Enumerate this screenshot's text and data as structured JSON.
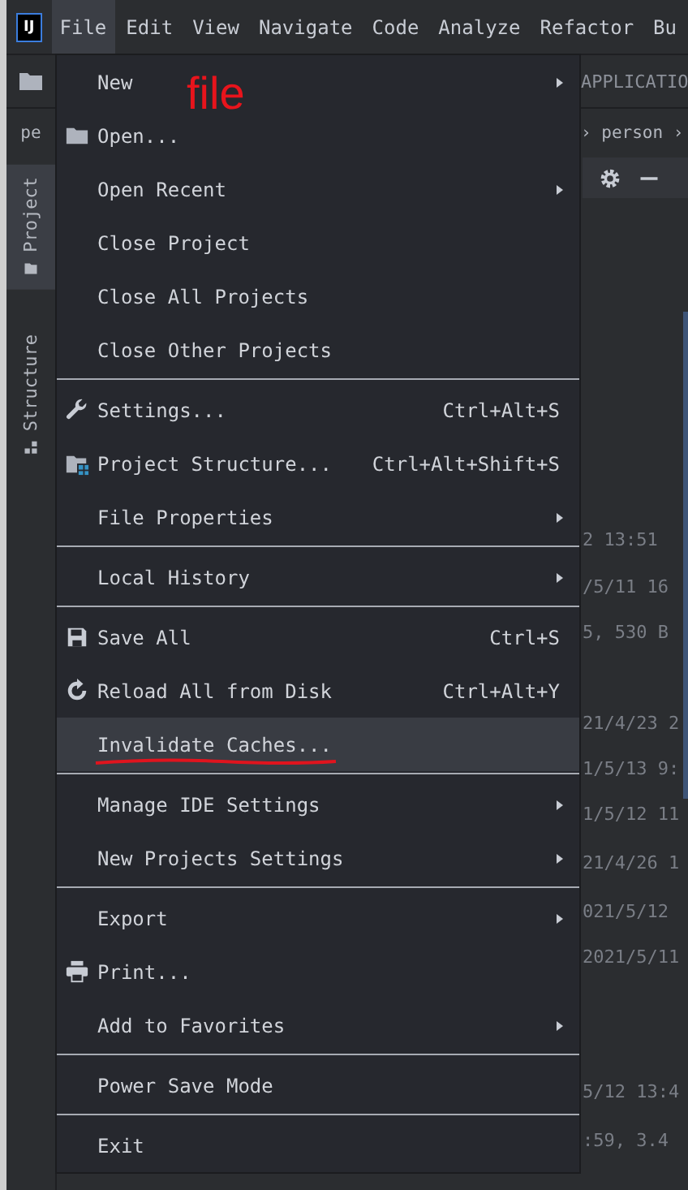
{
  "logo": "IJ",
  "menubar": [
    {
      "label": "File",
      "selected": true
    },
    {
      "label": "Edit",
      "selected": false
    },
    {
      "label": "View",
      "selected": false
    },
    {
      "label": "Navigate",
      "selected": false
    },
    {
      "label": "Code",
      "selected": false
    },
    {
      "label": "Analyze",
      "selected": false
    },
    {
      "label": "Refactor",
      "selected": false
    },
    {
      "label": "Bu",
      "selected": false
    }
  ],
  "toolbar": {
    "path": "APPLICATIO"
  },
  "navbar": {
    "left": "pe",
    "right": "› person ›"
  },
  "side_tabs": [
    {
      "label": "Project",
      "selected": true
    },
    {
      "label": "Structure",
      "selected": false
    }
  ],
  "file_menu": {
    "items": [
      {
        "kind": "item",
        "label": "New",
        "submenu": true,
        "selected": false,
        "underlined": false
      },
      {
        "kind": "item",
        "label": "Open...",
        "submenu": false,
        "selected": false,
        "underlined": false
      },
      {
        "kind": "item",
        "label": "Open Recent",
        "submenu": true,
        "selected": false,
        "underlined": false
      },
      {
        "kind": "item",
        "label": "Close Project",
        "submenu": false,
        "selected": false,
        "underlined": false
      },
      {
        "kind": "item",
        "label": "Close All Projects",
        "submenu": false,
        "selected": false,
        "underlined": false
      },
      {
        "kind": "item",
        "label": "Close Other Projects",
        "submenu": false,
        "selected": false,
        "underlined": false
      },
      {
        "kind": "separator"
      },
      {
        "kind": "item",
        "label": "Settings...",
        "shortcut": "Ctrl+Alt+S",
        "submenu": false,
        "selected": false,
        "underlined": false
      },
      {
        "kind": "item",
        "label": "Project Structure...",
        "shortcut": "Ctrl+Alt+Shift+S",
        "submenu": false,
        "selected": false,
        "underlined": false
      },
      {
        "kind": "item",
        "label": "File Properties",
        "submenu": true,
        "selected": false,
        "underlined": false
      },
      {
        "kind": "separator"
      },
      {
        "kind": "item",
        "label": "Local History",
        "submenu": true,
        "selected": false,
        "underlined": false
      },
      {
        "kind": "separator"
      },
      {
        "kind": "item",
        "label": "Save All",
        "shortcut": "Ctrl+S",
        "submenu": false,
        "selected": false,
        "underlined": false
      },
      {
        "kind": "item",
        "label": "Reload All from Disk",
        "shortcut": "Ctrl+Alt+Y",
        "submenu": false,
        "selected": false,
        "underlined": false
      },
      {
        "kind": "item",
        "label": "Invalidate Caches...",
        "submenu": false,
        "selected": true,
        "underlined": true
      },
      {
        "kind": "separator"
      },
      {
        "kind": "item",
        "label": "Manage IDE Settings",
        "submenu": true,
        "selected": false,
        "underlined": false
      },
      {
        "kind": "item",
        "label": "New Projects Settings",
        "submenu": true,
        "selected": false,
        "underlined": false
      },
      {
        "kind": "separator"
      },
      {
        "kind": "item",
        "label": "Export",
        "submenu": true,
        "selected": false,
        "underlined": false
      },
      {
        "kind": "item",
        "label": "Print...",
        "submenu": false,
        "selected": false,
        "underlined": false
      },
      {
        "kind": "item",
        "label": "Add to Favorites",
        "submenu": true,
        "selected": false,
        "underlined": false
      },
      {
        "kind": "separator"
      },
      {
        "kind": "item",
        "label": "Power Save Mode",
        "submenu": false,
        "selected": false,
        "underlined": false
      },
      {
        "kind": "separator"
      },
      {
        "kind": "item",
        "label": "Exit",
        "submenu": false,
        "selected": false,
        "underlined": false
      }
    ]
  },
  "background_rows": [
    "2 13:51",
    "/5/11 16",
    "5, 530 B",
    "21/4/23 2",
    "1/5/13 9:",
    "1/5/12 11",
    "21/4/26 1",
    "021/5/12",
    "2021/5/11",
    "5/12 13:4",
    ":59, 3.4"
  ],
  "annotation": {
    "text": "file"
  }
}
